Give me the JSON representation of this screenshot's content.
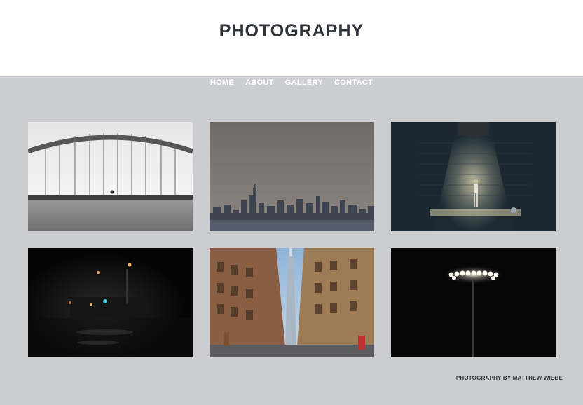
{
  "header": {
    "title": "PHOTOGRAPHY"
  },
  "nav": {
    "items": [
      {
        "label": "HOME"
      },
      {
        "label": "ABOUT"
      },
      {
        "label": "GALLERY"
      },
      {
        "label": "CONTACT"
      }
    ]
  },
  "gallery": {
    "photos": [
      {
        "subject": "bridge-arch-photo"
      },
      {
        "subject": "city-skyline-photo"
      },
      {
        "subject": "wall-light-figure-photo"
      },
      {
        "subject": "night-street-photo"
      },
      {
        "subject": "downtown-tower-street-photo"
      },
      {
        "subject": "stadium-light-photo"
      }
    ]
  },
  "footer": {
    "credit": "PHOTOGRAPHY BY MATTHEW WIEBE"
  },
  "colors": {
    "page_bg": "#cbcdd0",
    "header_bg": "#ffffff",
    "title": "#2f3338",
    "nav_text": "#ffffff"
  }
}
